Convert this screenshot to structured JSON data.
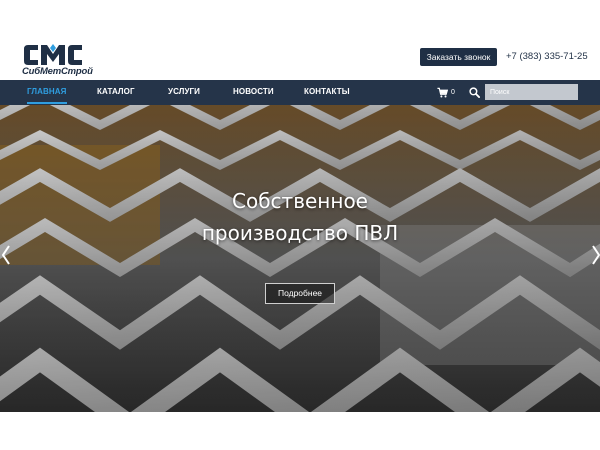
{
  "brand": {
    "logo_text": "СибМетСтрой",
    "color_dark": "#1f2f45",
    "accent": "#2f9ee0"
  },
  "header": {
    "call_button": "Заказать звонок",
    "phone": "+7 (383) 335-71-25"
  },
  "nav": {
    "items": [
      {
        "label": "Главная",
        "active": true
      },
      {
        "label": "Каталог",
        "active": false
      },
      {
        "label": "Услуги",
        "active": false
      },
      {
        "label": "Новости",
        "active": false
      },
      {
        "label": "Контакты",
        "active": false
      }
    ],
    "cart_icon": "cart-icon",
    "cart_count": "0",
    "search_icon": "search-icon",
    "search_placeholder": "Поиск"
  },
  "hero": {
    "title_line1": "Собственное",
    "title_line2": "производство ПВЛ",
    "button": "Подробнее",
    "prev_icon": "chevron-left-icon",
    "next_icon": "chevron-right-icon"
  }
}
